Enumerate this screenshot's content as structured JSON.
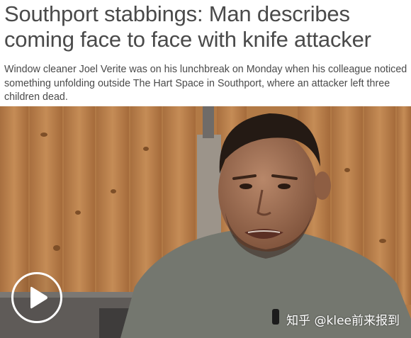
{
  "article": {
    "headline": "Southport stabbings: Man describes coming face to face with knife attacker",
    "standfirst": "Window cleaner Joel Verite was on his lunchbreak on Monday when his colleague noticed something unfolding outside The Hart Space in Southport, where an attacker left three children dead."
  },
  "video": {
    "play_icon": "play-icon",
    "watermark": "知乎 @klee前来报到"
  },
  "colors": {
    "text": "#4a4a4a",
    "fence": "#b9824d",
    "shirt": "#74776f"
  }
}
